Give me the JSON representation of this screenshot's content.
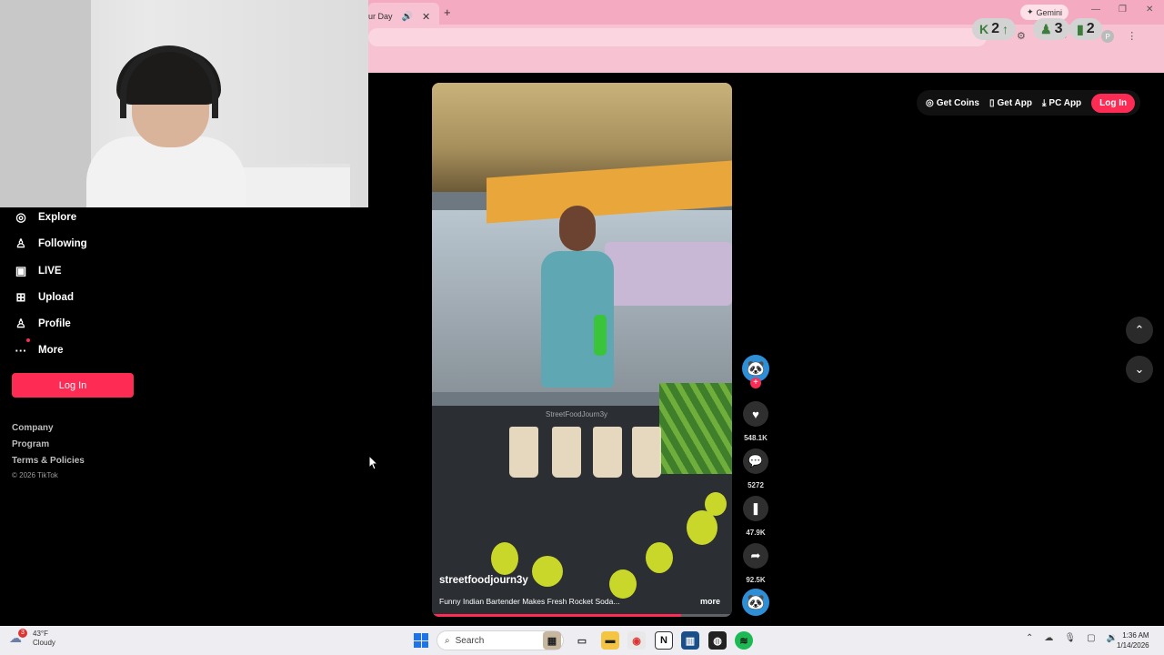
{
  "browser": {
    "tab_title": "ur Day",
    "new_tab_glyph": "+",
    "gemini_label": "Gemini",
    "profile_initial": "P"
  },
  "stream_overlay": [
    {
      "icon": "kick-icon",
      "value": "2",
      "glyph": "K",
      "suffix": "↑"
    },
    {
      "icon": "viewer-icon",
      "value": "3",
      "glyph": "♟",
      "suffix": ""
    },
    {
      "icon": "bars-icon",
      "value": "2",
      "glyph": "▮",
      "suffix": ""
    }
  ],
  "sidebar": {
    "items": [
      {
        "label": "Explore",
        "icon": "compass-icon",
        "glyph": "◎"
      },
      {
        "label": "Following",
        "icon": "following-icon",
        "glyph": "♙"
      },
      {
        "label": "LIVE",
        "icon": "live-icon",
        "glyph": "▣"
      },
      {
        "label": "Upload",
        "icon": "upload-icon",
        "glyph": "⊞"
      },
      {
        "label": "Profile",
        "icon": "profile-icon",
        "glyph": "♙"
      },
      {
        "label": "More",
        "icon": "more-icon",
        "glyph": "···"
      }
    ],
    "login_label": "Log In",
    "footer_links": [
      "Company",
      "Program",
      "Terms & Policies"
    ],
    "copyright": "© 2026 TikTok"
  },
  "top_actions": {
    "get_coins": "Get Coins",
    "get_app": "Get App",
    "pc_app": "PC App",
    "login": "Log In"
  },
  "video": {
    "author": "streetfoodjourn3y",
    "description": "Funny Indian Bartender Makes Fresh Rocket Soda...",
    "more": "more",
    "watermark": "StreetFoodJourn3y",
    "progress": 0.83
  },
  "actions": {
    "likes": "548.1K",
    "comments": "5272",
    "saves": "47.9K",
    "shares": "92.5K"
  },
  "taskbar": {
    "weather_temp": "43°F",
    "weather_cond": "Cloudy",
    "weather_badge": "3",
    "search_placeholder": "Search",
    "time": "1:36 AM",
    "date": "1/14/2026"
  },
  "colors": {
    "accent": "#fe2c55",
    "chrome": "#f7c3d2",
    "background": "#000000"
  }
}
